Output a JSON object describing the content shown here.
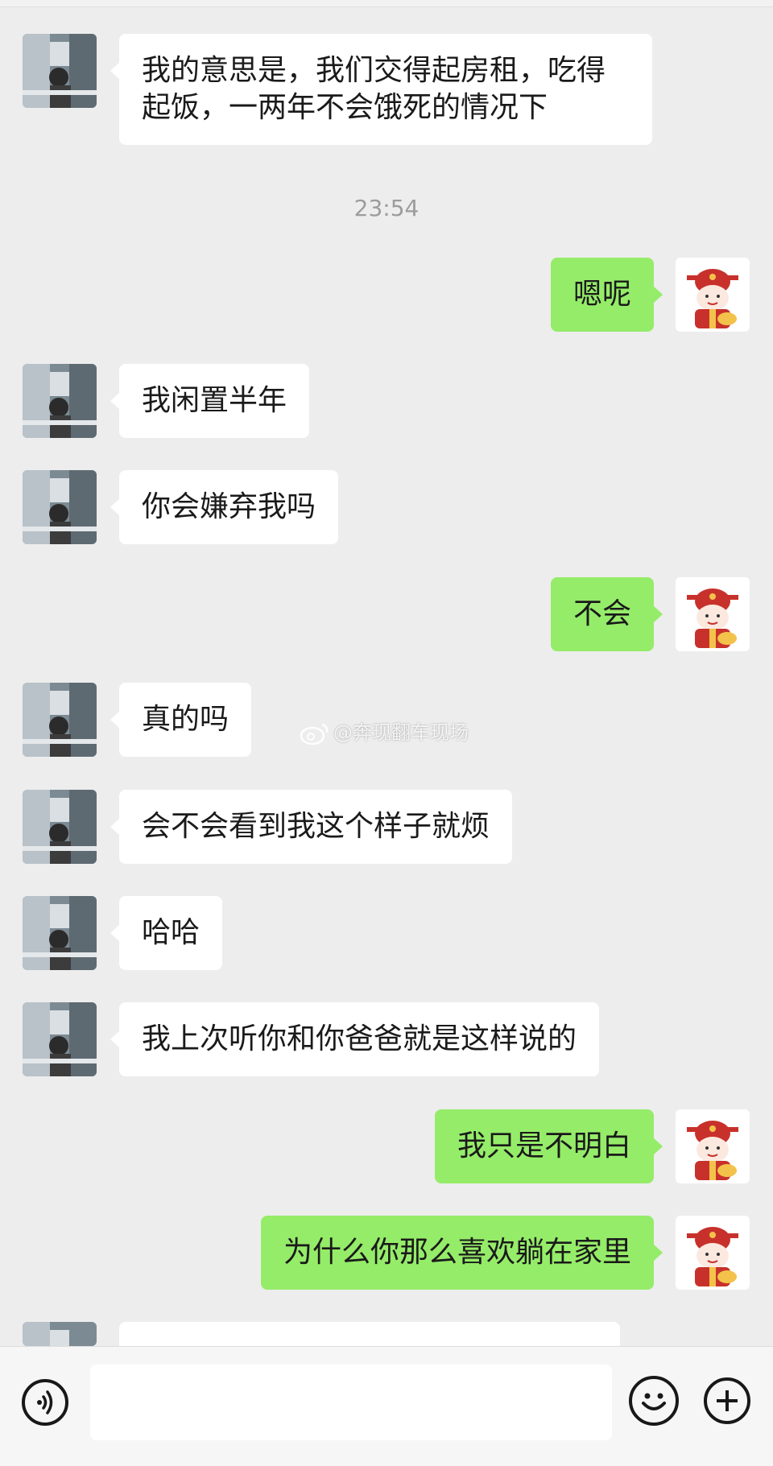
{
  "chat": {
    "timestamp": "23:54",
    "messages": [
      {
        "side": "in",
        "text": "我的意思是，我们交得起房租，吃得起饭，一两年不会饿死的情况下"
      },
      {
        "side": "out",
        "text": "嗯呢"
      },
      {
        "side": "in",
        "text": "我闲置半年"
      },
      {
        "side": "in",
        "text": "你会嫌弃我吗"
      },
      {
        "side": "out",
        "text": "不会"
      },
      {
        "side": "in",
        "text": "真的吗"
      },
      {
        "side": "in",
        "text": "会不会看到我这个样子就烦"
      },
      {
        "side": "in",
        "text": "哈哈"
      },
      {
        "side": "in",
        "text": "我上次听你和你爸爸就是这样说的"
      },
      {
        "side": "out",
        "text": "我只是不明白"
      },
      {
        "side": "out",
        "text": "为什么你那么喜欢躺在家里"
      }
    ]
  },
  "watermark": {
    "text": "@奔现翻车现场",
    "icon": "weibo-icon"
  },
  "input_bar": {
    "placeholder": "",
    "icons": [
      "voice-icon",
      "emoji-icon",
      "plus-icon"
    ]
  },
  "colors": {
    "background": "#ededed",
    "incoming_bubble": "#ffffff",
    "outgoing_bubble": "#95ec69",
    "timestamp": "#9c9c9c"
  }
}
